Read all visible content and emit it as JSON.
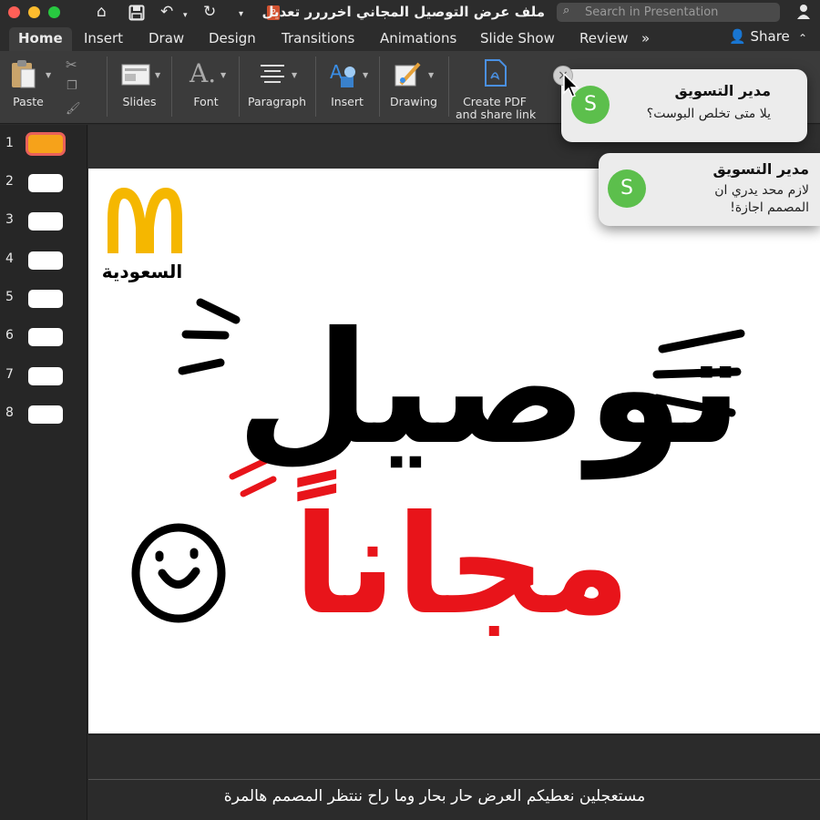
{
  "titlebar": {
    "document_title": "ملف عرض التوصيل المجاني اخرررر تعديل",
    "search_placeholder": "Search in Presentation"
  },
  "tabs": [
    "Home",
    "Insert",
    "Draw",
    "Design",
    "Transitions",
    "Animations",
    "Slide Show",
    "Review"
  ],
  "share_label": "Share",
  "ribbon": {
    "paste": "Paste",
    "slides": "Slides",
    "font": "Font",
    "paragraph": "Paragraph",
    "insert": "Insert",
    "drawing": "Drawing",
    "create_pdf_line1": "Create PDF",
    "create_pdf_line2": "and share link"
  },
  "thumbnails": [
    "1",
    "2",
    "3",
    "4",
    "5",
    "6",
    "7",
    "8"
  ],
  "slide": {
    "brand_text": "السعودية",
    "headline_black": "توصيل",
    "headline_red": "مجاناً"
  },
  "notifications": [
    {
      "avatar": "S",
      "sender": "مدير التسويق",
      "message": "يلا متى تخلص البوست؟"
    },
    {
      "avatar": "S",
      "sender": "مدير التسويق",
      "message_line1": "لازم محد يدري ان",
      "message_line2": "المصمم اجازة!"
    }
  ],
  "caption": "مستعجلين نعطيكم العرض حار بحار وما راح ننتظر المصمم هالمرة",
  "colors": {
    "accent_red": "#e8141a",
    "mcdonalds_yellow": "#f5b700",
    "avatar_green": "#5cbf4c"
  }
}
